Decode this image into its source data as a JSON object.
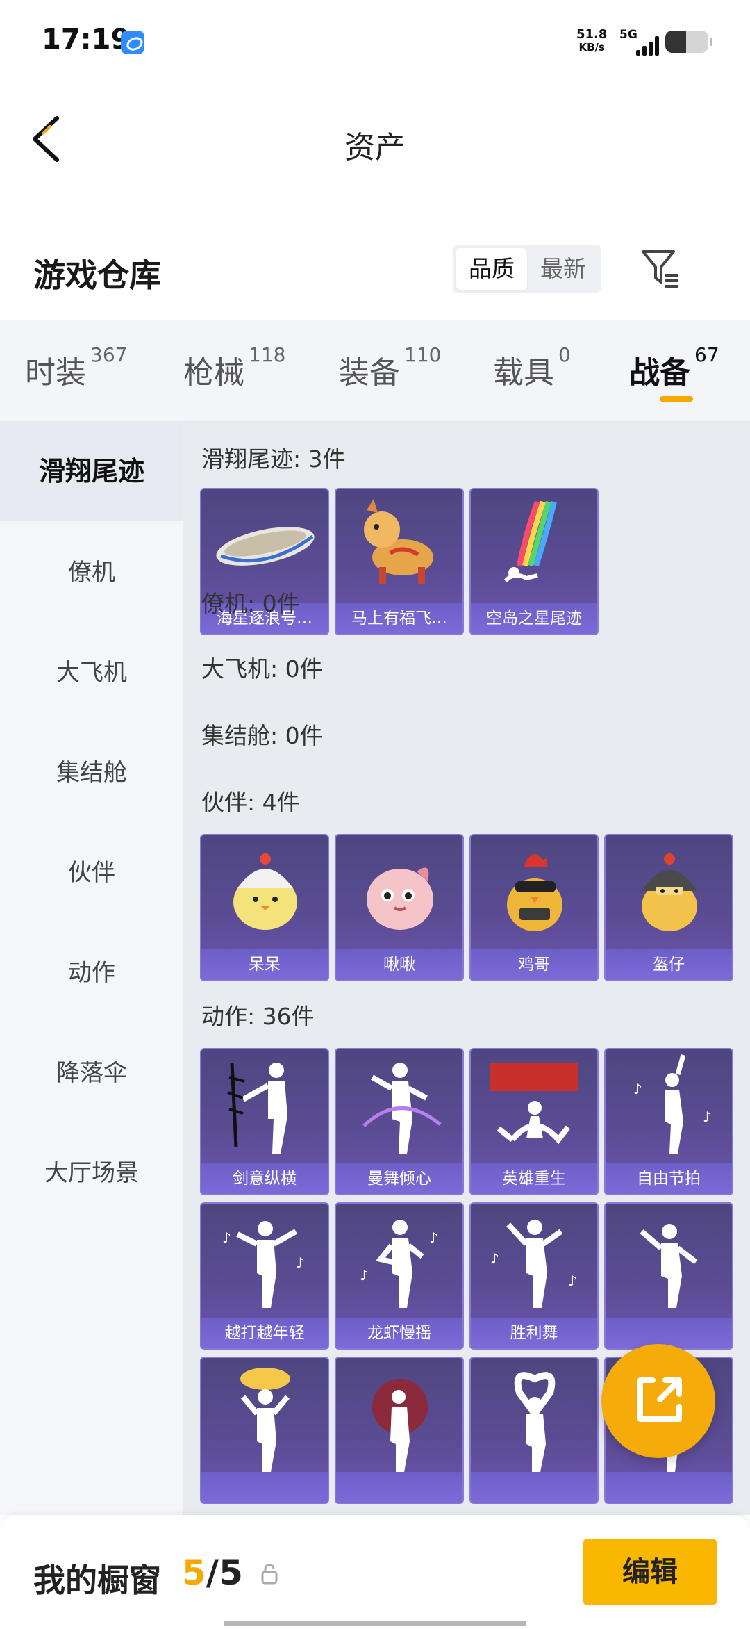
{
  "status_bar": {
    "time": "17:19",
    "net_speed": "51.8",
    "net_speed_unit": "KB/s",
    "network": "5G",
    "icons": [
      "browser-app-icon",
      "signal-icon",
      "battery-icon"
    ]
  },
  "header": {
    "title": "资产",
    "back_icon": "chevron-left-icon"
  },
  "warehouse": {
    "title": "游戏仓库",
    "sort_options": [
      "品质",
      "最新"
    ],
    "sort_selected": "品质",
    "filter_icon": "filter-icon"
  },
  "tabs": [
    {
      "label": "时装",
      "count": "367"
    },
    {
      "label": "枪械",
      "count": "118"
    },
    {
      "label": "装备",
      "count": "110"
    },
    {
      "label": "载具",
      "count": "0"
    },
    {
      "label": "战备",
      "count": "67",
      "active": true
    }
  ],
  "colors": {
    "accent": "#f5a800",
    "card_bg": "#5a4c93",
    "card_label": "#7d6ad8"
  },
  "sidebar": {
    "items": [
      {
        "label": "滑翔尾迹",
        "active": true
      },
      {
        "label": "僚机"
      },
      {
        "label": "大飞机"
      },
      {
        "label": "集结舱"
      },
      {
        "label": "伙伴"
      },
      {
        "label": "动作"
      },
      {
        "label": "降落伞"
      },
      {
        "label": "大厅场景"
      }
    ]
  },
  "sections": [
    {
      "title": "滑翔尾迹: 3件",
      "items": [
        "海星逐浪号…",
        "马上有福飞…",
        "空岛之星尾迹"
      ]
    },
    {
      "title": "僚机: 0件",
      "items": []
    },
    {
      "title": "大飞机: 0件",
      "items": []
    },
    {
      "title": "集结舱: 0件",
      "items": []
    },
    {
      "title": "伙伴: 4件",
      "items": [
        "呆呆",
        "啾啾",
        "鸡哥",
        "盔仔"
      ]
    },
    {
      "title": "动作: 36件",
      "items": [
        "剑意纵横",
        "曼舞倾心",
        "英雄重生",
        "自由节拍",
        "越打越年轻",
        "龙虾慢摇",
        "胜利舞",
        "",
        "",
        "",
        "",
        ""
      ]
    }
  ],
  "fab": {
    "icon": "share-external-icon"
  },
  "bottom_bar": {
    "label": "我的橱窗",
    "count_current": "5",
    "count_sep": "/",
    "count_total": "5",
    "lock_icon": "lock-icon",
    "edit_label": "编辑"
  }
}
